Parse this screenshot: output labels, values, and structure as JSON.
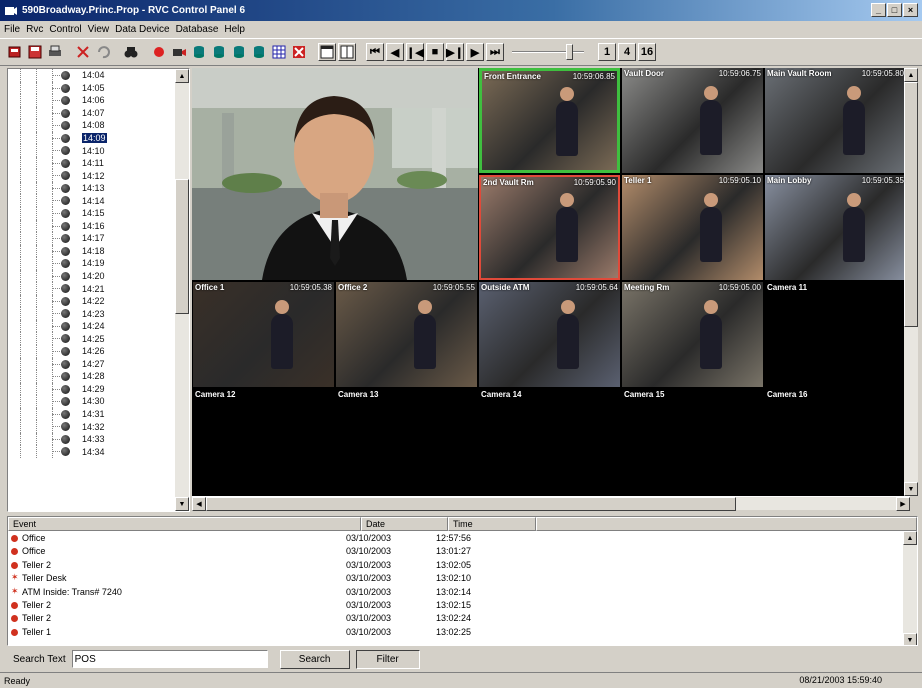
{
  "window": {
    "title": "590Broadway.Princ.Prop - RVC Control Panel 6",
    "controls": [
      "_",
      "□",
      "×"
    ]
  },
  "menu": [
    "File",
    "Rvc",
    "Control",
    "View",
    "Data Device",
    "Database",
    "Help"
  ],
  "toolbar": {
    "playback": [
      "⏮",
      "◀",
      "❙◀",
      "■",
      "▶❙",
      "▶",
      "⏭"
    ],
    "layouts": [
      "1",
      "4",
      "16"
    ]
  },
  "tree": {
    "items": [
      "14:04",
      "14:05",
      "14:06",
      "14:07",
      "14:08",
      "14:09",
      "14:10",
      "14:11",
      "14:12",
      "14:13",
      "14:14",
      "14:15",
      "14:16",
      "14:17",
      "14:18",
      "14:19",
      "14:20",
      "14:21",
      "14:22",
      "14:23",
      "14:24",
      "14:25",
      "14:26",
      "14:27",
      "14:28",
      "14:29",
      "14:30",
      "14:31",
      "14:32",
      "14:33",
      "14:34"
    ],
    "selected": "14:09"
  },
  "video": {
    "tiles": [
      {
        "caption": "Front Entrance",
        "time": "10:59:06.85"
      },
      {
        "caption": "Vault Door",
        "time": "10:59:06.75"
      },
      {
        "caption": "Main Vault Room",
        "time": "10:59:05.80"
      },
      {
        "caption": "2nd Vault Rm",
        "time": "10:59:05.90"
      },
      {
        "caption": "Teller 1",
        "time": "10:59:05.10"
      },
      {
        "caption": "Main Lobby",
        "time": "10:59:05.35"
      },
      {
        "caption": "Office 1",
        "time": "10:59:05.38"
      },
      {
        "caption": "Office 2",
        "time": "10:59:05.55"
      },
      {
        "caption": "Outside ATM",
        "time": "10:59:05.64"
      },
      {
        "caption": "Meeting Rm",
        "time": "10:59:05.00"
      },
      {
        "caption": "Camera 11",
        "time": ""
      },
      {
        "caption": "Camera 12",
        "time": ""
      },
      {
        "caption": "Camera 13",
        "time": ""
      },
      {
        "caption": "Camera 14",
        "time": ""
      },
      {
        "caption": "Camera 15",
        "time": ""
      },
      {
        "caption": "Camera 16",
        "time": ""
      }
    ]
  },
  "events": {
    "columns": [
      "Event",
      "Date",
      "Time"
    ],
    "rows": [
      {
        "marker": "dot",
        "event": "Office",
        "date": "03/10/2003",
        "time": "12:57:56"
      },
      {
        "marker": "dot",
        "event": "Office",
        "date": "03/10/2003",
        "time": "13:01:27"
      },
      {
        "marker": "dot",
        "event": "Teller 2",
        "date": "03/10/2003",
        "time": "13:02:05"
      },
      {
        "marker": "star",
        "event": "Teller Desk",
        "date": "03/10/2003",
        "time": "13:02:10"
      },
      {
        "marker": "star",
        "event": "ATM Inside: Trans# 7240",
        "date": "03/10/2003",
        "time": "13:02:14"
      },
      {
        "marker": "dot",
        "event": "Teller 2",
        "date": "03/10/2003",
        "time": "13:02:15"
      },
      {
        "marker": "dot",
        "event": "Teller 2",
        "date": "03/10/2003",
        "time": "13:02:24"
      },
      {
        "marker": "dot",
        "event": "Teller 1",
        "date": "03/10/2003",
        "time": "13:02:25"
      }
    ]
  },
  "search": {
    "label": "Search Text",
    "value": "POS",
    "search_button": "Search",
    "filter_button": "Filter"
  },
  "status": {
    "left": "Ready",
    "right": "08/21/2003 15:59:40"
  },
  "colors": {
    "title_bar": "#0a246a",
    "selection": "#0a246a",
    "event_marker": "#d0311f",
    "front_entrance_border": "#3fbf3f",
    "second_vault_border": "#e04a3a"
  }
}
